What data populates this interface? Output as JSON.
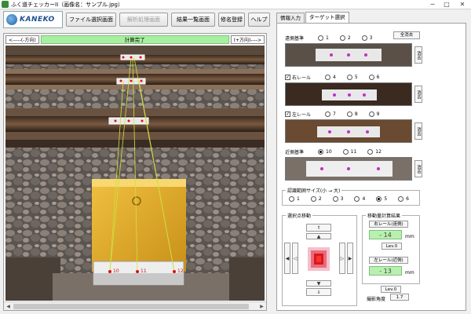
{
  "window": {
    "title": "ふく道チェッカーII（画像名：サンプル.jpg）"
  },
  "logo": {
    "brand": "KANEKO"
  },
  "toolbar": {
    "file_select": "ファイル選択画面",
    "analysis": "解析処理画面",
    "results": "結果一覧画面",
    "rename": "修名登録",
    "help": "ヘルプ"
  },
  "nav": {
    "left": "<-----(-方向)",
    "status": "計算完了",
    "right": "(+方向)---->"
  },
  "photo": {
    "labels": [
      "10",
      "11",
      "12"
    ]
  },
  "tabs": {
    "info_input": "情報入力",
    "target_select": "ターゲット選択"
  },
  "panel": {
    "far_ref": "遠側基準",
    "clear_all": "全消去",
    "right_rail": "右レール",
    "left_rail": "左レール",
    "near_ref": "近側基準",
    "clear": "消去",
    "options_row1": [
      "1",
      "2",
      "3"
    ],
    "options_row2": [
      "4",
      "5",
      "6"
    ],
    "options_row3": [
      "7",
      "8",
      "9"
    ],
    "options_row4": [
      "10",
      "11",
      "12"
    ],
    "search_range_label": "認識範囲サイズ(小 → 大)",
    "search_range_options": [
      "1",
      "2",
      "3",
      "4",
      "5",
      "6"
    ],
    "select_move_label": "選択点移動",
    "move_result_label": "移動量計算結果",
    "right_rail_far": "右レール(遠側)",
    "right_value": "- 14",
    "right_unit": "mm",
    "right_lev": "Lev.0",
    "left_rail_near": "左レール(近側)",
    "left_value": "- 13",
    "left_unit": "mm",
    "left_lev": "Lev.0",
    "angle_label": "撮影角度",
    "angle_value": "1.7"
  }
}
